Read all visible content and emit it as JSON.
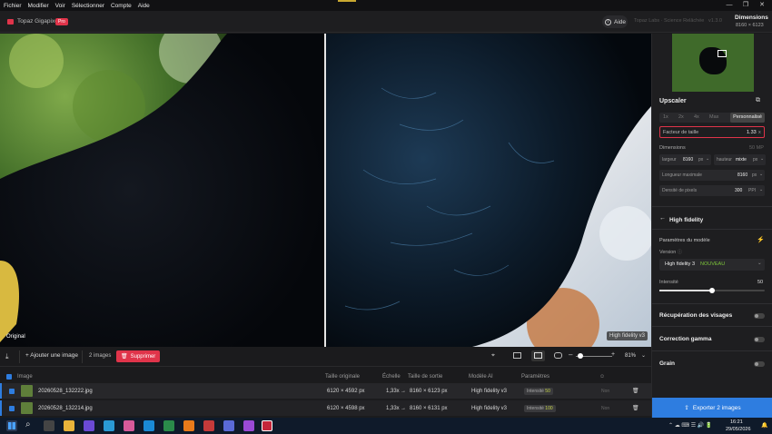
{
  "menu": {
    "items": [
      "Fichier",
      "Modifier",
      "Voir",
      "Sélectionner",
      "Compte",
      "Aide"
    ]
  },
  "header": {
    "app_name": "Topaz Gigapixel",
    "badge": "Pro",
    "help_label": "Aide",
    "brand_text": "Topaz Labs · Science Relâchée",
    "version": "v1.3.0",
    "dimensions_label": "Dimensions",
    "dimensions_value": "8160 × 6123"
  },
  "viewer": {
    "original_label": "Original",
    "model_label": "High fidelity v3"
  },
  "toolbar": {
    "add_image_label": "Ajouter une image",
    "image_count": "2 images",
    "delete_label": "Supprimer",
    "zoom_value": "81%"
  },
  "table": {
    "headers": [
      "Image",
      "Taille originale",
      "Échelle",
      "Taille de sortie",
      "Modèle AI",
      "Paramètres"
    ],
    "rows": [
      {
        "name": "20260528_132222.jpg",
        "original": "6120 × 4592 px",
        "scale": "1,33x",
        "arrow": "→",
        "output": "8160 × 6123 px",
        "model": "High fidelity v3",
        "param_label": "Intensité",
        "param_value": "50",
        "extra": "Non"
      },
      {
        "name": "20260528_132214.jpg",
        "original": "6120 × 4598 px",
        "scale": "1,33x",
        "arrow": "→",
        "output": "8160 × 6131 px",
        "model": "High fidelity v3",
        "param_label": "Intensité",
        "param_value": "100",
        "extra": "Non"
      }
    ]
  },
  "sidebar": {
    "upscaler_title": "Upscaler",
    "scale_tabs": [
      "1x",
      "2x",
      "4x",
      "Max",
      "Personnalisé"
    ],
    "factor_label": "Facteur de taille",
    "factor_value": "1.33",
    "factor_unit": "x",
    "dimensions_label": "Dimensions",
    "dimensions_mp": "50 MP",
    "width_label": "largeur",
    "width_value": "8160",
    "width_unit": "px",
    "height_label": "hauteur",
    "height_value": "mixte",
    "height_unit": "px",
    "longest_label": "Longueur maximale",
    "longest_value": "8160",
    "longest_unit": "px",
    "density_label": "Densité de pixels",
    "density_value": "300",
    "density_unit": "PPI",
    "model_title": "High fidelity",
    "model_params_label": "Paramètres du modèle",
    "version_label": "Version",
    "version_value": "High fidelity 3",
    "version_new": "NOUVEAU",
    "intensity_label": "Intensité",
    "intensity_value": "50",
    "intensity_fraction": 0.5,
    "face_recovery_label": "Récupération des visages",
    "gamma_label": "Correction gamma",
    "grain_label": "Grain",
    "export_label": "Exporter 2 images"
  },
  "taskbar": {
    "time": "16:21",
    "date": "29/05/2026"
  },
  "colors": {
    "accent_red": "#e0344a",
    "accent_blue": "#2e7de0",
    "accent_green": "#7ec83a"
  }
}
